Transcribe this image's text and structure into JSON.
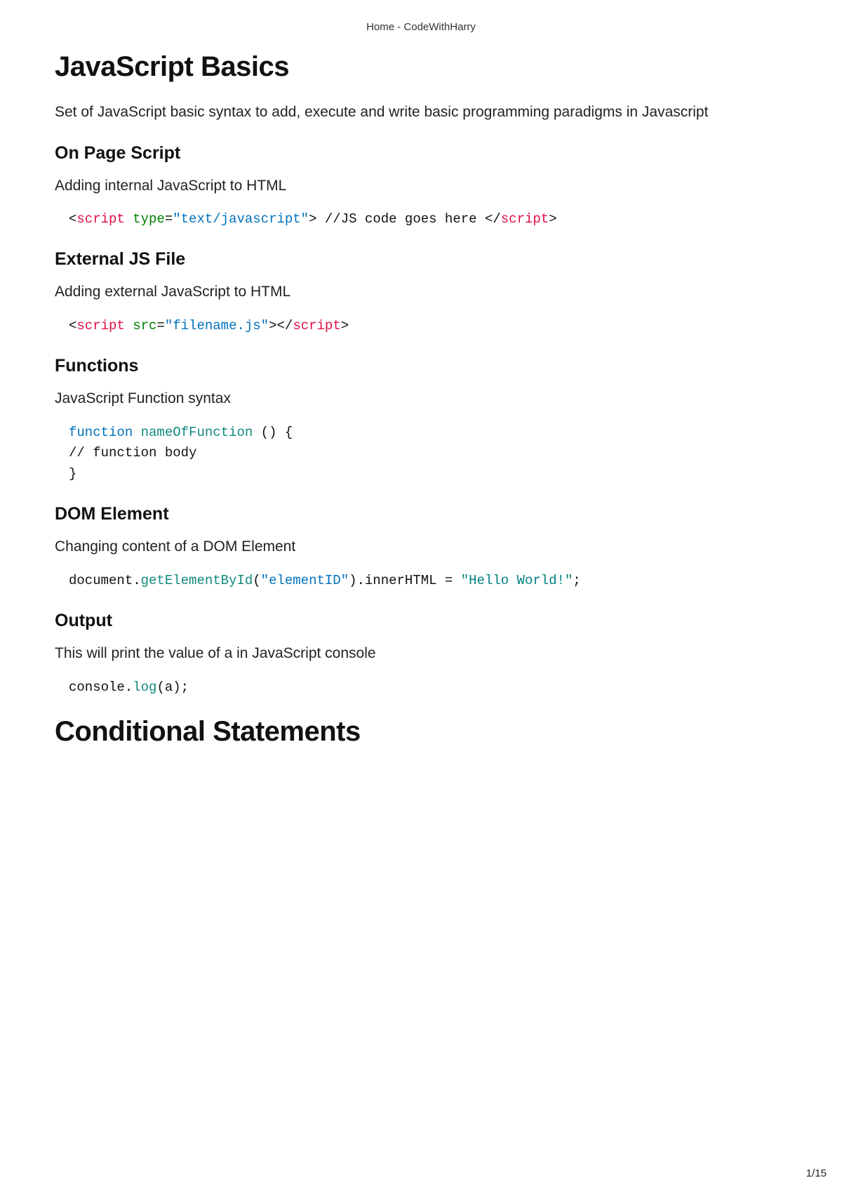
{
  "site_header": "Home - CodeWithHarry",
  "page_number": "1/15",
  "sections": {
    "js_basics": {
      "title": "JavaScript Basics",
      "desc": "Set of JavaScript basic syntax to add, execute and write basic programming paradigms in Javascript"
    },
    "on_page_script": {
      "heading": "On Page Script",
      "desc": "Adding internal JavaScript to HTML",
      "code": {
        "lt1": "<",
        "script_open": "script",
        "sp1": " ",
        "attr_type": "type",
        "eq1": "=",
        "val_type": "\"text/javascript\"",
        "gt1": ">",
        "body": " //JS code goes here ",
        "lt2": "</",
        "script_close": "script",
        "gt2": ">"
      }
    },
    "external_js": {
      "heading": "External JS File",
      "desc": "Adding external JavaScript to HTML",
      "code": {
        "lt1": "<",
        "script_open": "script",
        "sp1": " ",
        "attr_src": "src",
        "eq1": "=",
        "val_src": "\"filename.js\"",
        "gt1": ">",
        "lt2": "</",
        "script_close": "script",
        "gt2": ">"
      }
    },
    "functions": {
      "heading": "Functions",
      "desc": "JavaScript Function syntax",
      "code": {
        "kw_function": "function",
        "sp1": " ",
        "fn_name": "nameOfFunction",
        "rest_line1": " () {",
        "line2": "// function body ",
        "line3": "}"
      }
    },
    "dom_element": {
      "heading": "DOM Element",
      "desc": "Changing content of a DOM Element",
      "code": {
        "obj": "document.",
        "method": "getElementById",
        "open_paren": "(",
        "arg": "\"elementID\"",
        "after_call": ").innerHTML = ",
        "rhs": "\"Hello World!\"",
        "semi": ";"
      }
    },
    "output": {
      "heading": "Output",
      "desc": "This will print the value of a in JavaScript console",
      "code": {
        "obj": "console.",
        "method": "log",
        "rest": "(a);"
      }
    },
    "conditional": {
      "title": "Conditional Statements"
    }
  }
}
